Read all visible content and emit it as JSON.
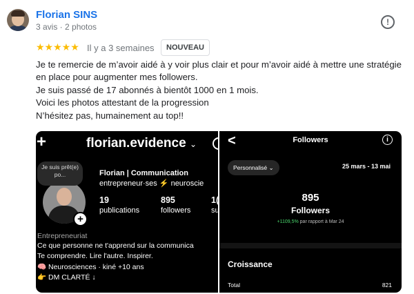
{
  "reviewer": {
    "name": "Florian SINS",
    "meta": "3 avis · 2 photos"
  },
  "review": {
    "stars": "★★★★★",
    "rating": 5,
    "date": "Il y a 3 semaines",
    "badge": "NOUVEAU",
    "lines": [
      "Je te remercie de m’avoir aidé à y voir plus clair et pour m’avoir aidé à mettre une stratégie",
      "en place pour augmenter mes followers.",
      "Je suis passé de 17 abonnés à bientôt 1000 en 1 mois.",
      "Voici les photos attestant de la progression",
      "N’hésitez pas, humainement au top!!"
    ],
    "info_icon": "!"
  },
  "photo1": {
    "plus": "+",
    "handle": "florian.evidence",
    "handle_chevron": "⌄",
    "note": "Je suis prêt(e) po...",
    "add": "+",
    "profile_name": "Florian | Communication",
    "category": "entrepreneur·ses ⚡ neuroscie",
    "stats": [
      {
        "value": "19",
        "label": "publications"
      },
      {
        "value": "895",
        "label": "followers"
      },
      {
        "value": "1(",
        "label": "su"
      }
    ],
    "bio": [
      "Entrepreneuriat",
      "Ce que personne ne t'apprend sur la communica",
      "Te comprendre. Lire l'autre. Inspirer.",
      "🧠 Neurosciences · kiné +10 ans",
      "👉 DM CLARTÉ ↓"
    ]
  },
  "photo2": {
    "back": "<",
    "title": "Followers",
    "info": "i",
    "dropdown": "Personnalisé ⌄",
    "range": "25 mars - 13 mai",
    "count": "895",
    "count_label": "Followers",
    "growth_value": "+1109,5%",
    "growth_text": " par rapport à Mar 24",
    "section": "Croissance",
    "total_label": "Total",
    "total_value": "821"
  }
}
